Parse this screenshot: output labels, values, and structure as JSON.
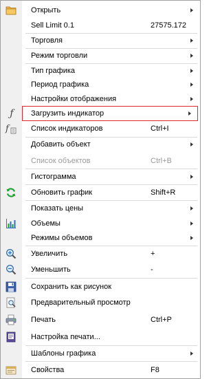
{
  "menu": {
    "items": [
      {
        "label": "Открыть",
        "shortcut": "",
        "submenu": true,
        "icon": "folder-icon"
      },
      {
        "label": "Sell Limit 0.1",
        "shortcut": "27575.172",
        "submenu": false,
        "icon": ""
      },
      {
        "label": "Торговля",
        "shortcut": "",
        "submenu": true,
        "icon": ""
      },
      {
        "label": "Режим торговли",
        "shortcut": "",
        "submenu": true,
        "icon": ""
      },
      {
        "label": "Тип графика",
        "shortcut": "",
        "submenu": true,
        "icon": ""
      },
      {
        "label": "Период графика",
        "shortcut": "",
        "submenu": true,
        "icon": ""
      },
      {
        "label": "Настройки отображения",
        "shortcut": "",
        "submenu": true,
        "icon": ""
      },
      {
        "label": "Загрузить индикатор",
        "shortcut": "",
        "submenu": true,
        "icon": "function-icon"
      },
      {
        "label": "Список индикаторов",
        "shortcut": "Ctrl+I",
        "submenu": false,
        "icon": "indicator-list-icon"
      },
      {
        "label": "Добавить объект",
        "shortcut": "",
        "submenu": true,
        "icon": ""
      },
      {
        "label": "Список объектов",
        "shortcut": "Ctrl+B",
        "submenu": false,
        "icon": "",
        "disabled": true
      },
      {
        "label": "Гистограмма",
        "shortcut": "",
        "submenu": true,
        "icon": ""
      },
      {
        "label": "Обновить график",
        "shortcut": "Shift+R",
        "submenu": false,
        "icon": "refresh-icon"
      },
      {
        "label": "Показать цены",
        "shortcut": "",
        "submenu": true,
        "icon": ""
      },
      {
        "label": "Объемы",
        "shortcut": "",
        "submenu": true,
        "icon": "volumes-chart-icon"
      },
      {
        "label": "Режимы объемов",
        "shortcut": "",
        "submenu": true,
        "icon": ""
      },
      {
        "label": "Увеличить",
        "shortcut": "+",
        "submenu": false,
        "icon": "zoom-in-icon"
      },
      {
        "label": "Уменьшить",
        "shortcut": "-",
        "submenu": false,
        "icon": "zoom-out-icon"
      },
      {
        "label": "Сохранить как рисунок",
        "shortcut": "",
        "submenu": false,
        "icon": "save-image-icon"
      },
      {
        "label": "Предварительный просмотр",
        "shortcut": "",
        "submenu": false,
        "icon": "print-preview-icon"
      },
      {
        "label": "Печать",
        "shortcut": "Ctrl+P",
        "submenu": false,
        "icon": "printer-icon"
      },
      {
        "label": "Настройка печати...",
        "shortcut": "",
        "submenu": false,
        "icon": "print-setup-icon"
      },
      {
        "label": "Шаблоны графика",
        "shortcut": "",
        "submenu": true,
        "icon": ""
      },
      {
        "label": "Свойства",
        "shortcut": "F8",
        "submenu": false,
        "icon": "properties-icon"
      }
    ]
  },
  "colors": {
    "highlight_border": "#e0262b",
    "disabled_text": "#9a9a9a",
    "gutter": "#f0f0f0"
  }
}
